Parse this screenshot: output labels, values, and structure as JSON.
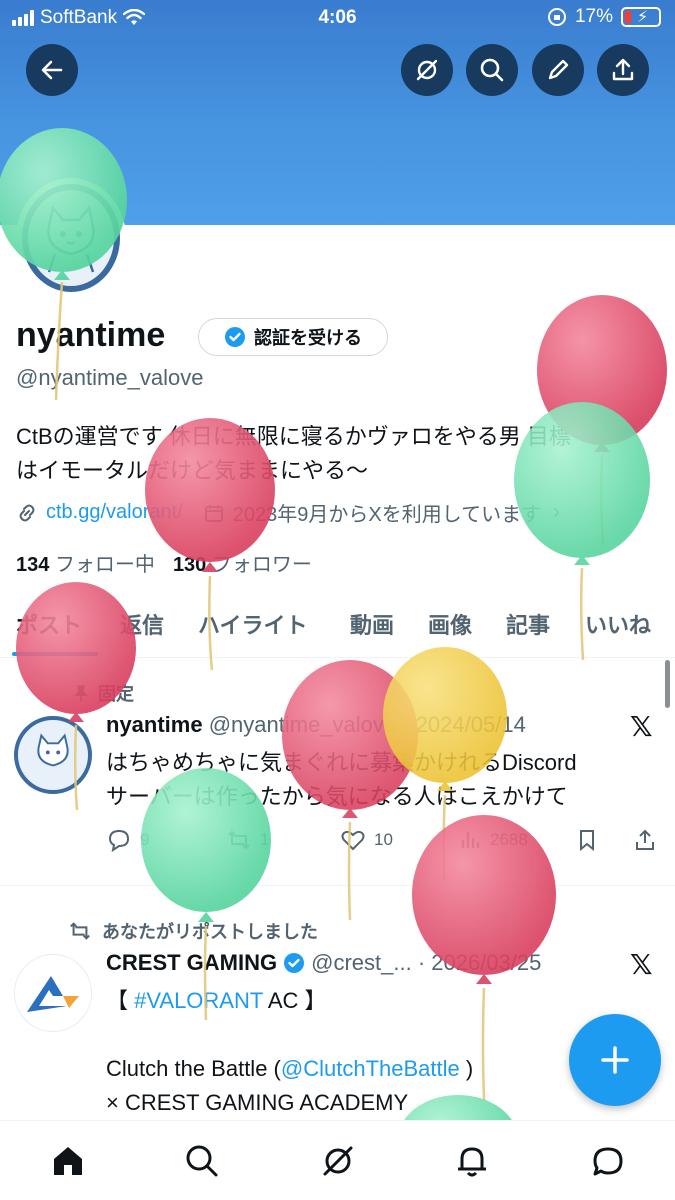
{
  "status_bar": {
    "carrier": "SoftBank",
    "time": "4:06",
    "battery": "17%"
  },
  "profile": {
    "name": "nyantime",
    "verify_label": "認証を受ける",
    "handle": "@nyantime_valove",
    "bio_line1": "CtBの運営です 休日に無限に寝るかヴァロをやる男 目標",
    "bio_line2": "はイモータルだけど気ままにやる〜",
    "link": "ctb.gg/valorant/",
    "joined": "2023年9月からXを利用しています",
    "following_count": "134",
    "following_label": "フォロー中",
    "followers_count": "130",
    "followers_label": "フォロワー"
  },
  "tabs": [
    "ポスト",
    "返信",
    "ハイライト",
    "動画",
    "画像",
    "記事",
    "いいね"
  ],
  "pinned_post": {
    "pinned_label": "固定",
    "author": "nyantime",
    "handle_date": "@nyantime_valove · 2024/05/14",
    "text_line1": "はちゃめちゃに気まぐれに募集かけれるDiscord",
    "text_line2": "サーバーは作ったから気になる人はこえかけて",
    "replies": "9",
    "reposts": "1",
    "likes": "10",
    "views": "2688"
  },
  "repost": {
    "repost_label": "あなたがリポストしました",
    "author": "CREST GAMING",
    "handle_date": "@crest_... · 2026/03/25",
    "line1_pre": "【 ",
    "line1_tag": "#VALORANT",
    "line1_post": " AC 】",
    "line3_pre": "Clutch the Battle (",
    "line3_mention": "@ClutchTheBattle",
    "line3_post": " )",
    "line4": "× CREST GAMING ACADEMY"
  },
  "colors": {
    "accent": "#1d9bf0",
    "banner": "#4a90e2",
    "balloon_red": "#e0506e",
    "balloon_green": "#6fe0b0",
    "balloon_yellow": "#f2cf4a"
  }
}
